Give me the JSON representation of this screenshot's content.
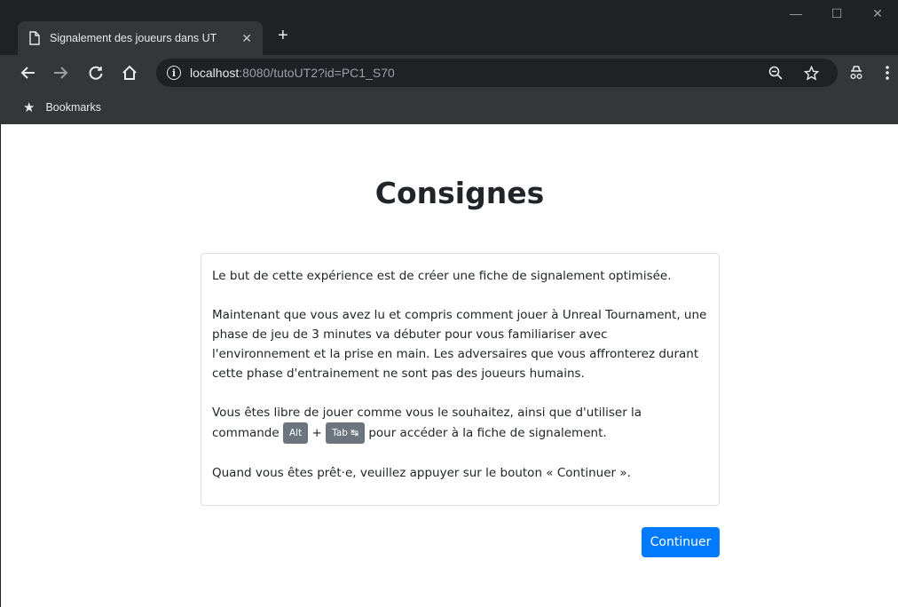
{
  "browser": {
    "tab_title": "Signalement des joueurs dans UT",
    "tab_close": "✕",
    "new_tab": "+",
    "window_controls": {
      "minimize": "—",
      "maximize": "☐",
      "close": "✕"
    },
    "url_host": "localhost",
    "url_rest": ":8080/tutoUT2?id=PC1_S70",
    "bookmarks_label": "Bookmarks",
    "icons": [
      "file-icon",
      "back-icon",
      "forward-icon",
      "reload-icon",
      "home-icon",
      "info-icon",
      "zoom-icon",
      "star-icon",
      "incognito-icon",
      "menu-icon"
    ]
  },
  "page": {
    "title": "Consignes",
    "paragraph1": "Le but de cette expérience est de créer une fiche de signalement optimisée.",
    "paragraph2": "Maintenant que vous avez lu et compris comment jouer à Unreal Tournament, une phase de jeu de 3 minutes va débuter pour vous familiariser avec l'environnement et la prise en main. Les adversaires que vous affronterez durant cette phase d'entrainement ne sont pas des joueurs humains.",
    "paragraph3_before": "Vous êtes libre de jouer comme vous le souhaitez, ainsi que d'utiliser la commande ",
    "key_alt": "Alt",
    "plus": " + ",
    "key_tab": "Tab ↹",
    "paragraph3_after": " pour accéder à la fiche de signalement.",
    "paragraph4": "Quand vous êtes prêt·e, veuillez appuyer sur le bouton « Continuer ».",
    "continue_button": "Continuer"
  },
  "colors": {
    "accent": "#007bff",
    "kbd": "#6c757d",
    "chrome_dark": "#202124",
    "chrome_toolbar": "#35363a"
  }
}
